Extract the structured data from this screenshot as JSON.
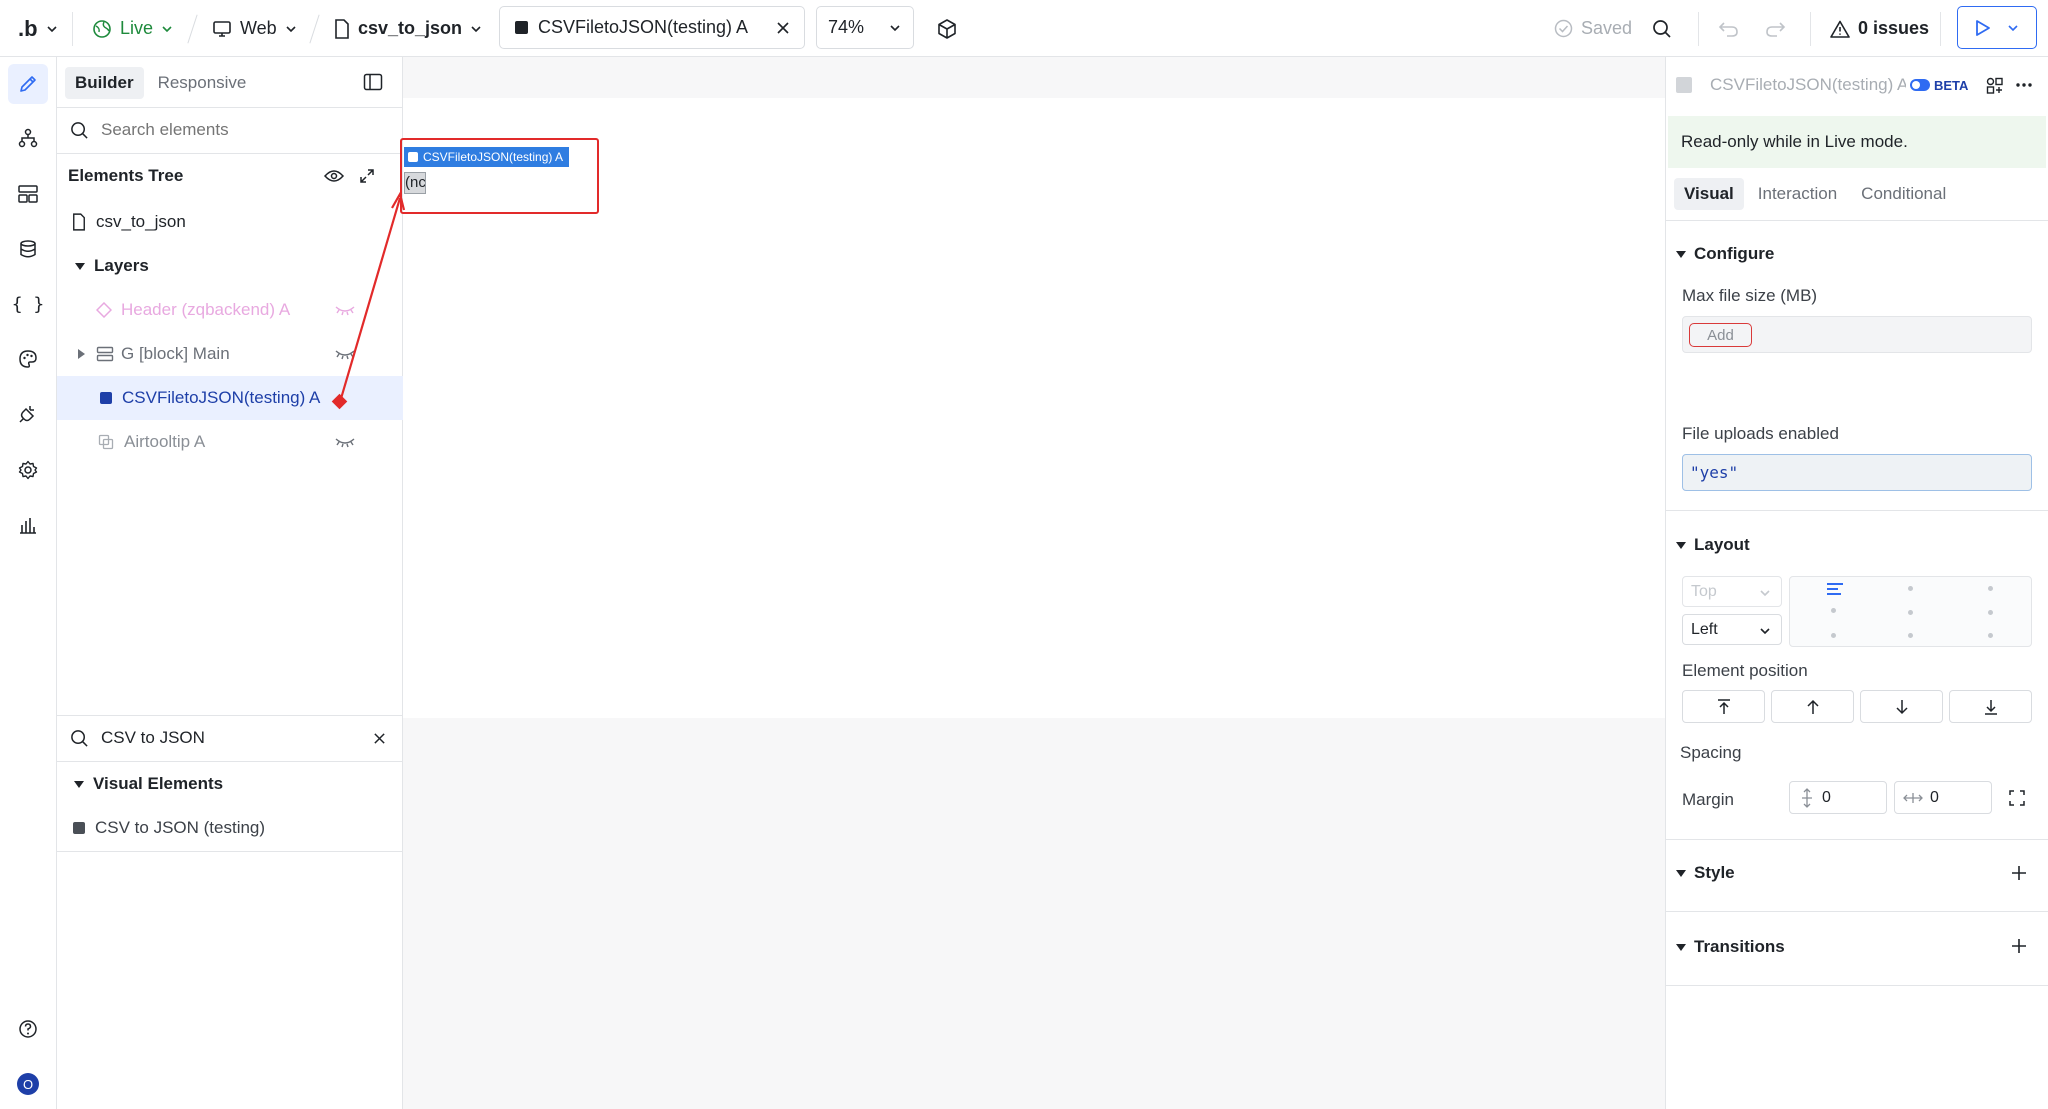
{
  "topbar": {
    "logo": ".b",
    "environment": "Live",
    "platform": "Web",
    "page_name": "csv_to_json",
    "component_tab": "CSVFiletoJSON(testing) A",
    "zoom": "74%",
    "saved_label": "Saved",
    "issues_label": "0 issues"
  },
  "left_panel": {
    "tabs": [
      "Builder",
      "Responsive"
    ],
    "search_placeholder": "Search elements",
    "tree_title": "Elements Tree",
    "page_item": "csv_to_json",
    "layers_label": "Layers",
    "layers": [
      {
        "label": "Header (zqbackend) A"
      },
      {
        "label": "G [block] Main"
      },
      {
        "label": "CSVFiletoJSON(testing) A"
      },
      {
        "label": "Airtooltip A"
      }
    ],
    "component_search_value": "CSV to JSON",
    "visual_elements_label": "Visual Elements",
    "visual_elements": [
      {
        "label": "CSV to JSON (testing)"
      }
    ]
  },
  "canvas": {
    "selected_label": "CSVFiletoJSON(testing) A",
    "element_text": "(nc"
  },
  "right_panel": {
    "title": "CSVFiletoJSON(testing) A",
    "beta_label": "BETA",
    "notice": "Read-only while in Live mode.",
    "tabs": [
      "Visual",
      "Interaction",
      "Conditional"
    ],
    "configure_label": "Configure",
    "max_file_size_label": "Max file size (MB)",
    "add_label": "Add",
    "file_uploads_label": "File uploads enabled",
    "file_uploads_value": "\"yes\"",
    "layout_label": "Layout",
    "vertical_align": "Top",
    "horizontal_align": "Left",
    "element_position_label": "Element position",
    "spacing_label": "Spacing",
    "margin_label": "Margin",
    "margin_vertical": "0",
    "margin_horizontal": "0",
    "style_label": "Style",
    "transitions_label": "Transitions"
  },
  "user": {
    "avatar_initial": "O"
  },
  "colors": {
    "accent": "#2f6bf2",
    "live": "#1e8a3c",
    "selection": "#e22a2a",
    "badge_blue": "#2f7de1",
    "header_pink": "#e8a9e0"
  }
}
